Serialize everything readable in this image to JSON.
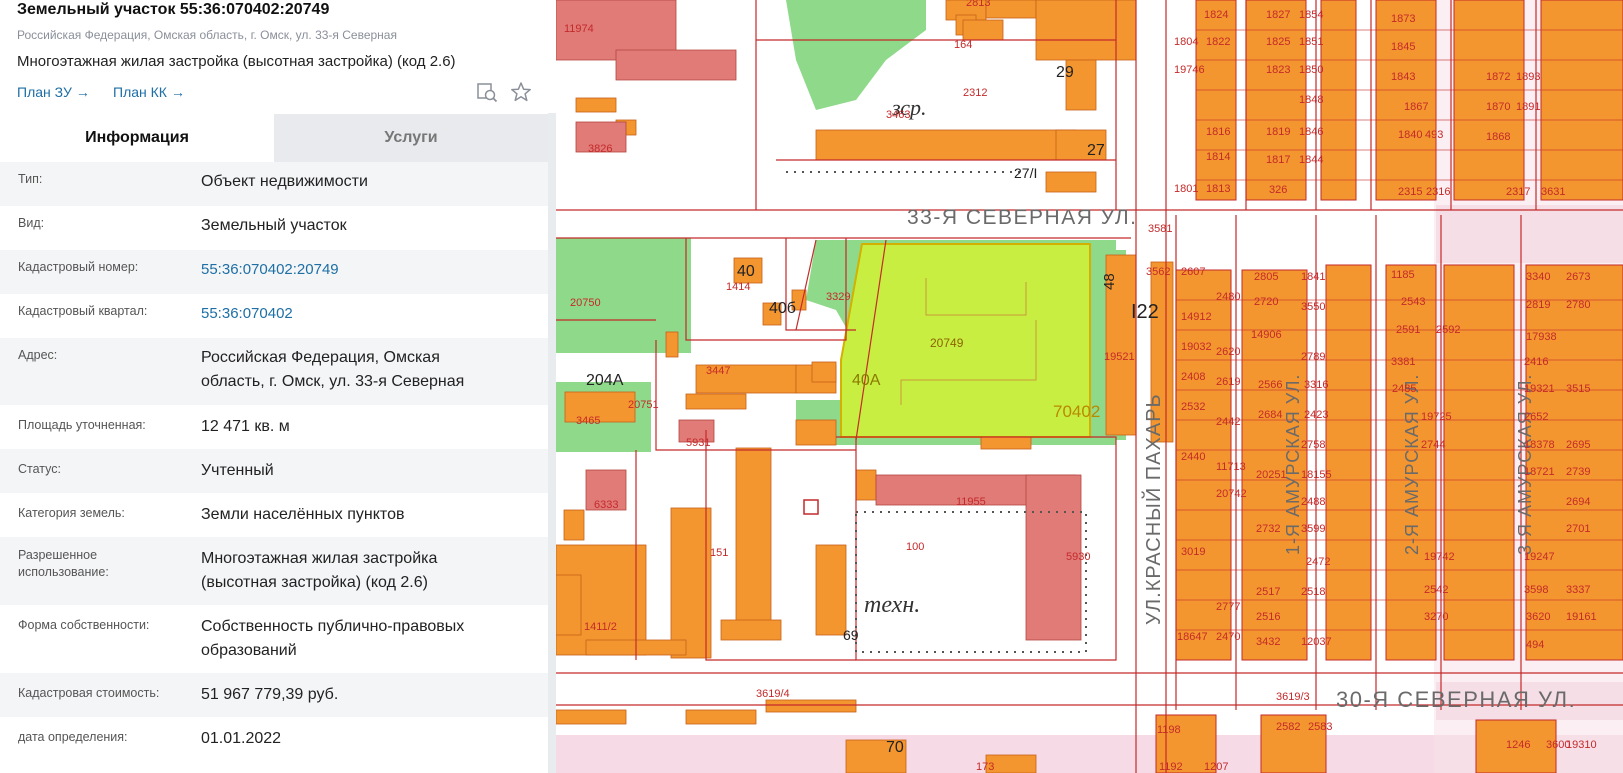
{
  "header": {
    "title": "Земельный участок 55:36:070402:20749",
    "address": "Российская Федерация, Омская область, г. Омск, ул. 33-я Северная",
    "usage": "Многоэтажная жилая застройка (высотная застройка) (код 2.6)",
    "link_plan_zu": "План ЗУ",
    "link_plan_kk": "План КК",
    "icons": [
      "search-map-icon",
      "star-icon"
    ]
  },
  "tabs": {
    "info": "Информация",
    "services": "Услуги"
  },
  "rows": [
    {
      "label": "Тип:",
      "value": "Объект недвижимости"
    },
    {
      "label": "Вид:",
      "value": "Земельный участок"
    },
    {
      "label": "Кадастровый номер:",
      "value": "55:36:070402:20749"
    },
    {
      "label": "Кадастровый квартал:",
      "value": "55:36:070402"
    },
    {
      "label": "Адрес:",
      "value": "Российская Федерация, Омская область, г. Омск, ул. 33-я Северная"
    },
    {
      "label": "Площадь уточненная:",
      "value": "12 471 кв. м"
    },
    {
      "label": "Статус:",
      "value": "Учтенный"
    },
    {
      "label": "Категория земель:",
      "value": "Земли населённых пунктов"
    },
    {
      "label": "Разрешенное использование:",
      "value": "Многоэтажная жилая застройка (высотная застройка) (код 2.6)"
    },
    {
      "label": "Форма собственности:",
      "value": "Собственность публично-правовых образований"
    },
    {
      "label": "Кадастровая стоимость:",
      "value": "51 967 779,39 руб."
    },
    {
      "label": "дата определения:",
      "value": "01.01.2022"
    }
  ],
  "map": {
    "colors": {
      "building": "#f4962f",
      "building_pink": "#e07b78",
      "green": "#8fd98a",
      "selected": "#c9ee42",
      "boundary": "#c42a2a",
      "road_band": "#f2d3df"
    },
    "streets": [
      "33-Я СЕВЕРНАЯ УЛ.",
      "УЛ.КРАСНЫЙ ПАХАРЬ",
      "30-Я СЕВЕРНАЯ УЛ.",
      "1-Я АМУРСКАЯ УЛ.",
      "2-Я АМУРСКАЯ УЛ.",
      "3-Я АМУРСКАЯ УЛ."
    ],
    "areas": [
      "зср.",
      "техн."
    ],
    "selected_parcel": "20749",
    "quarter": "70402",
    "big_numbers": [
      "40",
      "40б",
      "40А",
      "204А",
      "27",
      "29",
      "27/I",
      "48",
      "I22",
      "69",
      "70"
    ],
    "parcel_numbers": [
      "11974",
      "2813",
      "164",
      "2312",
      "3463",
      "3826",
      "1414",
      "3329",
      "20750",
      "3447",
      "20751",
      "3465",
      "5931",
      "6333",
      "151",
      "1411/2",
      "11955",
      "100",
      "5930",
      "19521",
      "3581",
      "3562",
      "3619/4",
      "3619/3",
      "173",
      "1198",
      "1192",
      "1207",
      "1824",
      "1804",
      "1822",
      "19746",
      "1816",
      "1814",
      "1813",
      "1801",
      "1827",
      "1854",
      "1825",
      "1851",
      "1823",
      "1850",
      "1848",
      "1819",
      "1846",
      "1817",
      "1844",
      "326",
      "1873",
      "1845",
      "1843",
      "1867",
      "1840",
      "493",
      "1872",
      "1893",
      "1870",
      "1891",
      "1868",
      "2315",
      "2316",
      "2317",
      "3631",
      "2607",
      "2480",
      "14912",
      "19032",
      "2620",
      "2408",
      "2619",
      "2532",
      "2442",
      "2440",
      "11713",
      "20742",
      "3019",
      "2777",
      "18647",
      "2470",
      "2805",
      "1841",
      "2720",
      "3550",
      "14906",
      "2789",
      "2566",
      "3316",
      "2684",
      "2423",
      "2758",
      "20251",
      "18155",
      "2488",
      "2732",
      "3599",
      "2472",
      "2517",
      "2518",
      "2516",
      "3432",
      "12037",
      "1185",
      "2543",
      "2591",
      "2592",
      "3381",
      "2485",
      "19725",
      "2744",
      "3340",
      "2673",
      "2819",
      "2780",
      "17938",
      "2416",
      "19321",
      "3515",
      "2652",
      "18378",
      "2695",
      "18721",
      "2739",
      "2694",
      "2701",
      "19742",
      "19247",
      "2542",
      "3598",
      "3337",
      "3270",
      "3620",
      "19161",
      "494",
      "2582",
      "2583",
      "1246",
      "3600",
      "19310"
    ]
  }
}
